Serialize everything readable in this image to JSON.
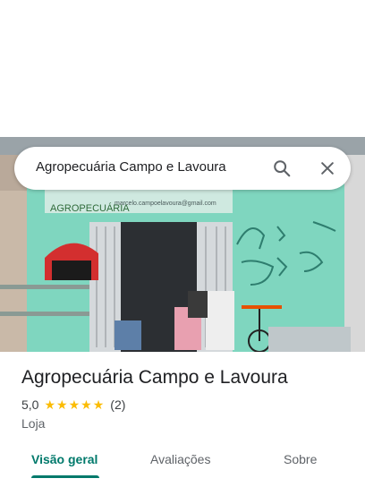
{
  "search": {
    "query": "Agropecuária Campo e Lavoura"
  },
  "icons": {
    "search": "search-icon",
    "close": "close-icon",
    "star": "star-icon"
  },
  "photo": {
    "sign_text": "AGROPECUÁRIA",
    "sign_email": "marcelo.campoelavoura@gmail.com"
  },
  "place": {
    "title": "Agropecuária Campo e Lavoura",
    "rating": "5,0",
    "stars": 5,
    "reviews": "(2)",
    "category": "Loja"
  },
  "tabs": [
    {
      "label": "Visão geral",
      "active": true
    },
    {
      "label": "Avaliações",
      "active": false
    },
    {
      "label": "Sobre",
      "active": false
    }
  ],
  "colors": {
    "accent": "#00796b",
    "star": "#fbbc04",
    "wall": "#7fcfb8"
  }
}
